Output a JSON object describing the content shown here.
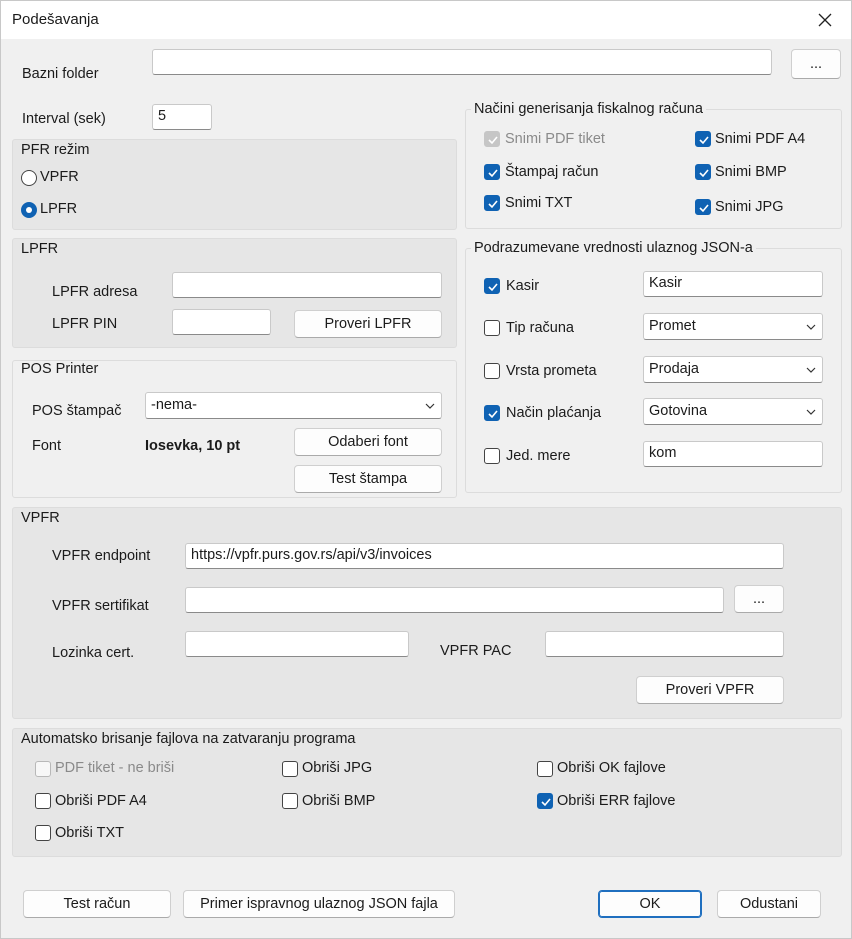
{
  "window": {
    "title": "Podešavanja",
    "close_glyph": "✕"
  },
  "base": {
    "folder_label": "Bazni folder",
    "folder_value": "",
    "browse_label": "...",
    "interval_label": "Interval (sek)",
    "interval_value": "5"
  },
  "pfr_mode": {
    "title": "PFR režim",
    "options": [
      {
        "label": "VPFR",
        "checked": false
      },
      {
        "label": "LPFR",
        "checked": true
      }
    ]
  },
  "lpfr": {
    "title": "LPFR",
    "address_label": "LPFR adresa",
    "address_value": "",
    "pin_label": "LPFR PIN",
    "pin_value": "",
    "check_button": "Proveri LPFR"
  },
  "pos_printer": {
    "title": "POS Printer",
    "printer_label": "POS štampač",
    "printer_value": "-nema-",
    "font_label": "Font",
    "font_value": "Iosevka, 10 pt",
    "choose_font_button": "Odaberi font",
    "test_print_button": "Test štampa"
  },
  "fiscal_generation": {
    "title": "Načini generisanja fiskalnog računa",
    "options": [
      {
        "label": "Snimi PDF tiket",
        "checked": true,
        "disabled": true
      },
      {
        "label": "Snimi PDF A4",
        "checked": true,
        "disabled": false
      },
      {
        "label": "Štampaj račun",
        "checked": true,
        "disabled": false
      },
      {
        "label": "Snimi BMP",
        "checked": true,
        "disabled": false
      },
      {
        "label": "Snimi TXT",
        "checked": true,
        "disabled": false
      },
      {
        "label": "Snimi JPG",
        "checked": true,
        "disabled": false
      }
    ]
  },
  "json_defaults": {
    "title": "Podrazumevane vrednosti ulaznog JSON-a",
    "rows": [
      {
        "label": "Kasir",
        "checked": true,
        "kind": "text",
        "value": "Kasir"
      },
      {
        "label": "Tip računa",
        "checked": false,
        "kind": "select",
        "value": "Promet"
      },
      {
        "label": "Vrsta prometa",
        "checked": false,
        "kind": "select",
        "value": "Prodaja"
      },
      {
        "label": "Način plaćanja",
        "checked": true,
        "kind": "select",
        "value": "Gotovina"
      },
      {
        "label": "Jed. mere",
        "checked": false,
        "kind": "text",
        "value": "kom"
      }
    ]
  },
  "vpfr": {
    "title": "VPFR",
    "endpoint_label": "VPFR endpoint",
    "endpoint_value": "https://vpfr.purs.gov.rs/api/v3/invoices",
    "cert_label": "VPFR sertifikat",
    "cert_value": "",
    "cert_browse": "...",
    "password_label": "Lozinka cert.",
    "password_value": "",
    "pac_label": "VPFR PAC",
    "pac_value": "",
    "check_button": "Proveri VPFR"
  },
  "auto_delete": {
    "title": "Automatsko brisanje fajlova na zatvaranju programa",
    "options": [
      {
        "label": "PDF tiket - ne briši",
        "checked": false,
        "disabled": true
      },
      {
        "label": "Obriši JPG",
        "checked": false,
        "disabled": false
      },
      {
        "label": "Obriši OK fajlove",
        "checked": false,
        "disabled": false
      },
      {
        "label": "Obriši PDF A4",
        "checked": false,
        "disabled": false
      },
      {
        "label": "Obriši BMP",
        "checked": false,
        "disabled": false
      },
      {
        "label": "Obriši ERR fajlove",
        "checked": true,
        "disabled": false
      },
      {
        "label": "Obriši TXT",
        "checked": false,
        "disabled": false
      }
    ]
  },
  "footer": {
    "test_invoice": "Test račun",
    "sample_json": "Primer ispravnog ulaznog JSON fajla",
    "ok": "OK",
    "cancel": "Odustani"
  },
  "colors": {
    "accent": "#0f62b3",
    "panel_shaded": "#e6e6e6",
    "background": "#f0f0f0"
  }
}
